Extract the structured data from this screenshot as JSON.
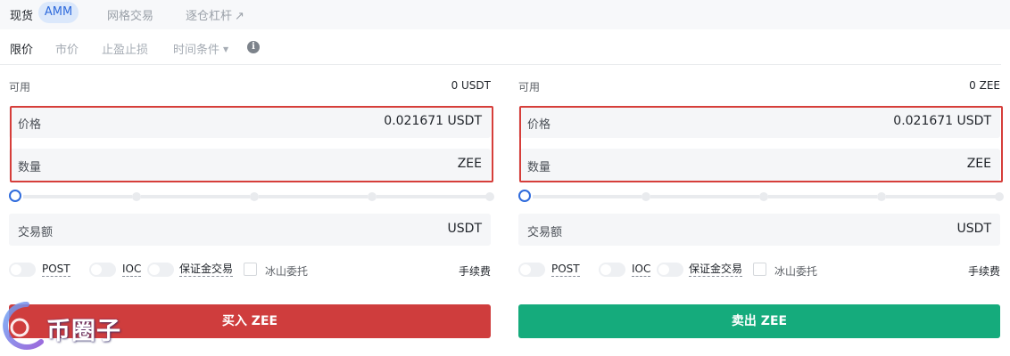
{
  "top_tabs": {
    "spot": "现货",
    "amm": "AMM",
    "grid": "网格交易",
    "isolated_margin": "逐仓杠杆"
  },
  "order_types": {
    "limit": "限价",
    "market": "市价",
    "tp_sl": "止盈止损",
    "time_condition": "时间条件"
  },
  "buy_panel": {
    "available_label": "可用",
    "available_value": "0 USDT",
    "price_label": "价格",
    "price_value": "0.021671 USDT",
    "amount_label": "数量",
    "amount_unit": "ZEE",
    "total_label": "交易额",
    "total_unit": "USDT",
    "options": {
      "post": "POST",
      "ioc": "IOC",
      "margin": "保证金交易",
      "iceberg": "冰山委托"
    },
    "fee_label": "手续费",
    "action_label": "买入 ZEE"
  },
  "sell_panel": {
    "available_label": "可用",
    "available_value": "0 ZEE",
    "price_label": "价格",
    "price_value": "0.021671 USDT",
    "amount_label": "数量",
    "amount_unit": "ZEE",
    "total_label": "交易额",
    "total_unit": "USDT",
    "options": {
      "post": "POST",
      "ioc": "IOC",
      "margin": "保证金交易",
      "iceberg": "冰山委托"
    },
    "fee_label": "手续费",
    "action_label": "卖出 ZEE"
  },
  "slider": {
    "value_percent": 0,
    "steps_percent": [
      0,
      25,
      50,
      75,
      100
    ]
  },
  "watermark": {
    "text": "币圈子"
  },
  "colors": {
    "accent": "#2f6bdc",
    "buy": "#cf3d3d",
    "sell": "#15ab7c",
    "highlight": "#d63e3a"
  },
  "icons": {
    "external": "arrow-up-right-icon",
    "dropdown": "caret-down-icon",
    "info": "info-icon"
  }
}
